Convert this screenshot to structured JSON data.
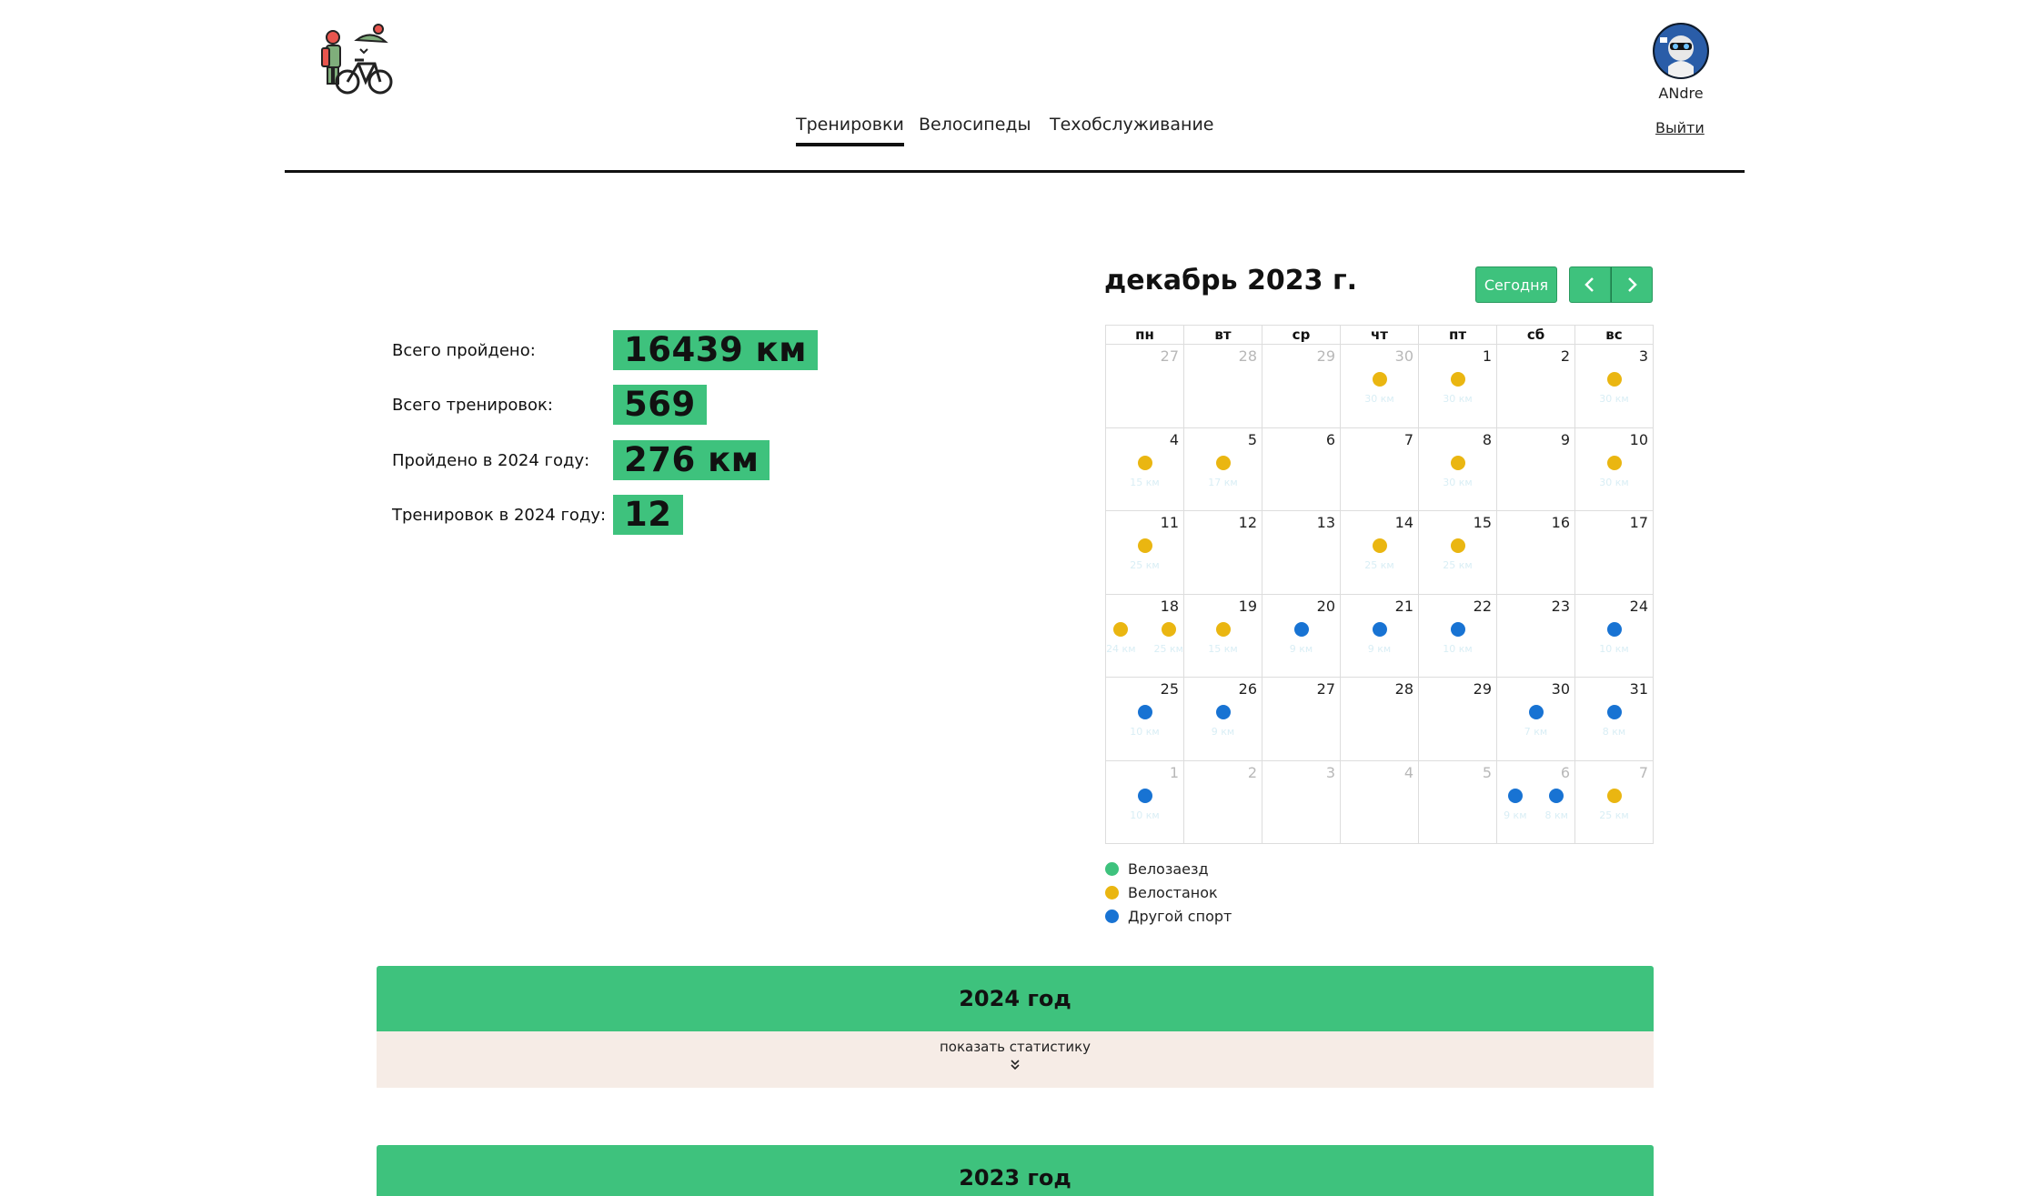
{
  "header": {
    "logo_icon": "cyclist-with-bicycle-icon",
    "nav": [
      {
        "label": "Тренировки",
        "active": true
      },
      {
        "label": "Велосипеды",
        "active": false
      },
      {
        "label": "Техобслуживание",
        "active": false
      }
    ],
    "user": {
      "name": "ANdre",
      "avatar_icon": "user-avatar"
    },
    "logout_label": "Выйти"
  },
  "stats": [
    {
      "label": "Всего пройдено:",
      "value": "16439 км"
    },
    {
      "label": "Всего тренировок:",
      "value": "569"
    },
    {
      "label": "Пройдено в 2024 году:",
      "value": "276 км"
    },
    {
      "label": "Тренировок в 2024 году:",
      "value": "12"
    }
  ],
  "calendar": {
    "title": "декабрь 2023 г.",
    "today_label": "Сегодня",
    "prev_icon": "chevron-left-icon",
    "next_icon": "chevron-right-icon",
    "weekdays": [
      "пн",
      "вт",
      "ср",
      "чт",
      "пт",
      "сб",
      "вс"
    ],
    "colors": {
      "ride": "#3ec27d",
      "trainer": "#eab611",
      "other": "#1873d3"
    },
    "weeks": [
      [
        {
          "day": "27",
          "other": true,
          "events": []
        },
        {
          "day": "28",
          "other": true,
          "events": []
        },
        {
          "day": "29",
          "other": true,
          "events": []
        },
        {
          "day": "30",
          "other": true,
          "events": [
            {
              "type": "trainer",
              "km": "30 км"
            }
          ]
        },
        {
          "day": "1",
          "other": false,
          "events": [
            {
              "type": "trainer",
              "km": "30 км"
            }
          ]
        },
        {
          "day": "2",
          "other": false,
          "events": []
        },
        {
          "day": "3",
          "other": false,
          "events": [
            {
              "type": "trainer",
              "km": "30 км"
            }
          ]
        }
      ],
      [
        {
          "day": "4",
          "other": false,
          "events": [
            {
              "type": "trainer",
              "km": "15 км"
            }
          ]
        },
        {
          "day": "5",
          "other": false,
          "events": [
            {
              "type": "trainer",
              "km": "17 км"
            }
          ]
        },
        {
          "day": "6",
          "other": false,
          "events": []
        },
        {
          "day": "7",
          "other": false,
          "events": []
        },
        {
          "day": "8",
          "other": false,
          "events": [
            {
              "type": "trainer",
              "km": "30 км"
            }
          ]
        },
        {
          "day": "9",
          "other": false,
          "events": []
        },
        {
          "day": "10",
          "other": false,
          "events": [
            {
              "type": "trainer",
              "km": "30 км"
            }
          ]
        }
      ],
      [
        {
          "day": "11",
          "other": false,
          "events": [
            {
              "type": "trainer",
              "km": "25 км"
            }
          ]
        },
        {
          "day": "12",
          "other": false,
          "events": []
        },
        {
          "day": "13",
          "other": false,
          "events": []
        },
        {
          "day": "14",
          "other": false,
          "events": [
            {
              "type": "trainer",
              "km": "25 км"
            }
          ]
        },
        {
          "day": "15",
          "other": false,
          "events": [
            {
              "type": "trainer",
              "km": "25 км"
            }
          ]
        },
        {
          "day": "16",
          "other": false,
          "events": []
        },
        {
          "day": "17",
          "other": false,
          "events": []
        }
      ],
      [
        {
          "day": "18",
          "other": false,
          "events": [
            {
              "type": "trainer",
              "km": "24 км"
            },
            {
              "type": "trainer",
              "km": "25 км"
            }
          ]
        },
        {
          "day": "19",
          "other": false,
          "events": [
            {
              "type": "trainer",
              "km": "15 км"
            }
          ]
        },
        {
          "day": "20",
          "other": false,
          "events": [
            {
              "type": "other",
              "km": "9 км"
            }
          ]
        },
        {
          "day": "21",
          "other": false,
          "events": [
            {
              "type": "other",
              "km": "9 км"
            }
          ]
        },
        {
          "day": "22",
          "other": false,
          "events": [
            {
              "type": "other",
              "km": "10 км"
            }
          ]
        },
        {
          "day": "23",
          "other": false,
          "events": []
        },
        {
          "day": "24",
          "other": false,
          "events": [
            {
              "type": "other",
              "km": "10 км"
            }
          ]
        }
      ],
      [
        {
          "day": "25",
          "other": false,
          "events": [
            {
              "type": "other",
              "km": "10 км"
            }
          ]
        },
        {
          "day": "26",
          "other": false,
          "events": [
            {
              "type": "other",
              "km": "9 км"
            }
          ]
        },
        {
          "day": "27",
          "other": false,
          "events": []
        },
        {
          "day": "28",
          "other": false,
          "events": []
        },
        {
          "day": "29",
          "other": false,
          "events": []
        },
        {
          "day": "30",
          "other": false,
          "events": [
            {
              "type": "other",
              "km": "7 км"
            }
          ]
        },
        {
          "day": "31",
          "other": false,
          "events": [
            {
              "type": "other",
              "km": "8 км"
            }
          ]
        }
      ],
      [
        {
          "day": "1",
          "other": true,
          "events": [
            {
              "type": "other",
              "km": "10 км"
            }
          ]
        },
        {
          "day": "2",
          "other": true,
          "events": []
        },
        {
          "day": "3",
          "other": true,
          "events": []
        },
        {
          "day": "4",
          "other": true,
          "events": []
        },
        {
          "day": "5",
          "other": true,
          "events": []
        },
        {
          "day": "6",
          "other": true,
          "events": [
            {
              "type": "other",
              "km": "9 км"
            },
            {
              "type": "other",
              "km": "8 км"
            }
          ]
        },
        {
          "day": "7",
          "other": true,
          "events": [
            {
              "type": "trainer",
              "km": "25 км"
            }
          ]
        }
      ]
    ],
    "legend": [
      {
        "label": "Велозаезд",
        "type": "ride"
      },
      {
        "label": "Велостанок",
        "type": "trainer"
      },
      {
        "label": "Другой спорт",
        "type": "other"
      }
    ]
  },
  "years": [
    {
      "title": "2024 год",
      "stats_label": "показать статистику",
      "expand_icon": "double-chevron-down-icon"
    },
    {
      "title": "2023 год"
    }
  ]
}
